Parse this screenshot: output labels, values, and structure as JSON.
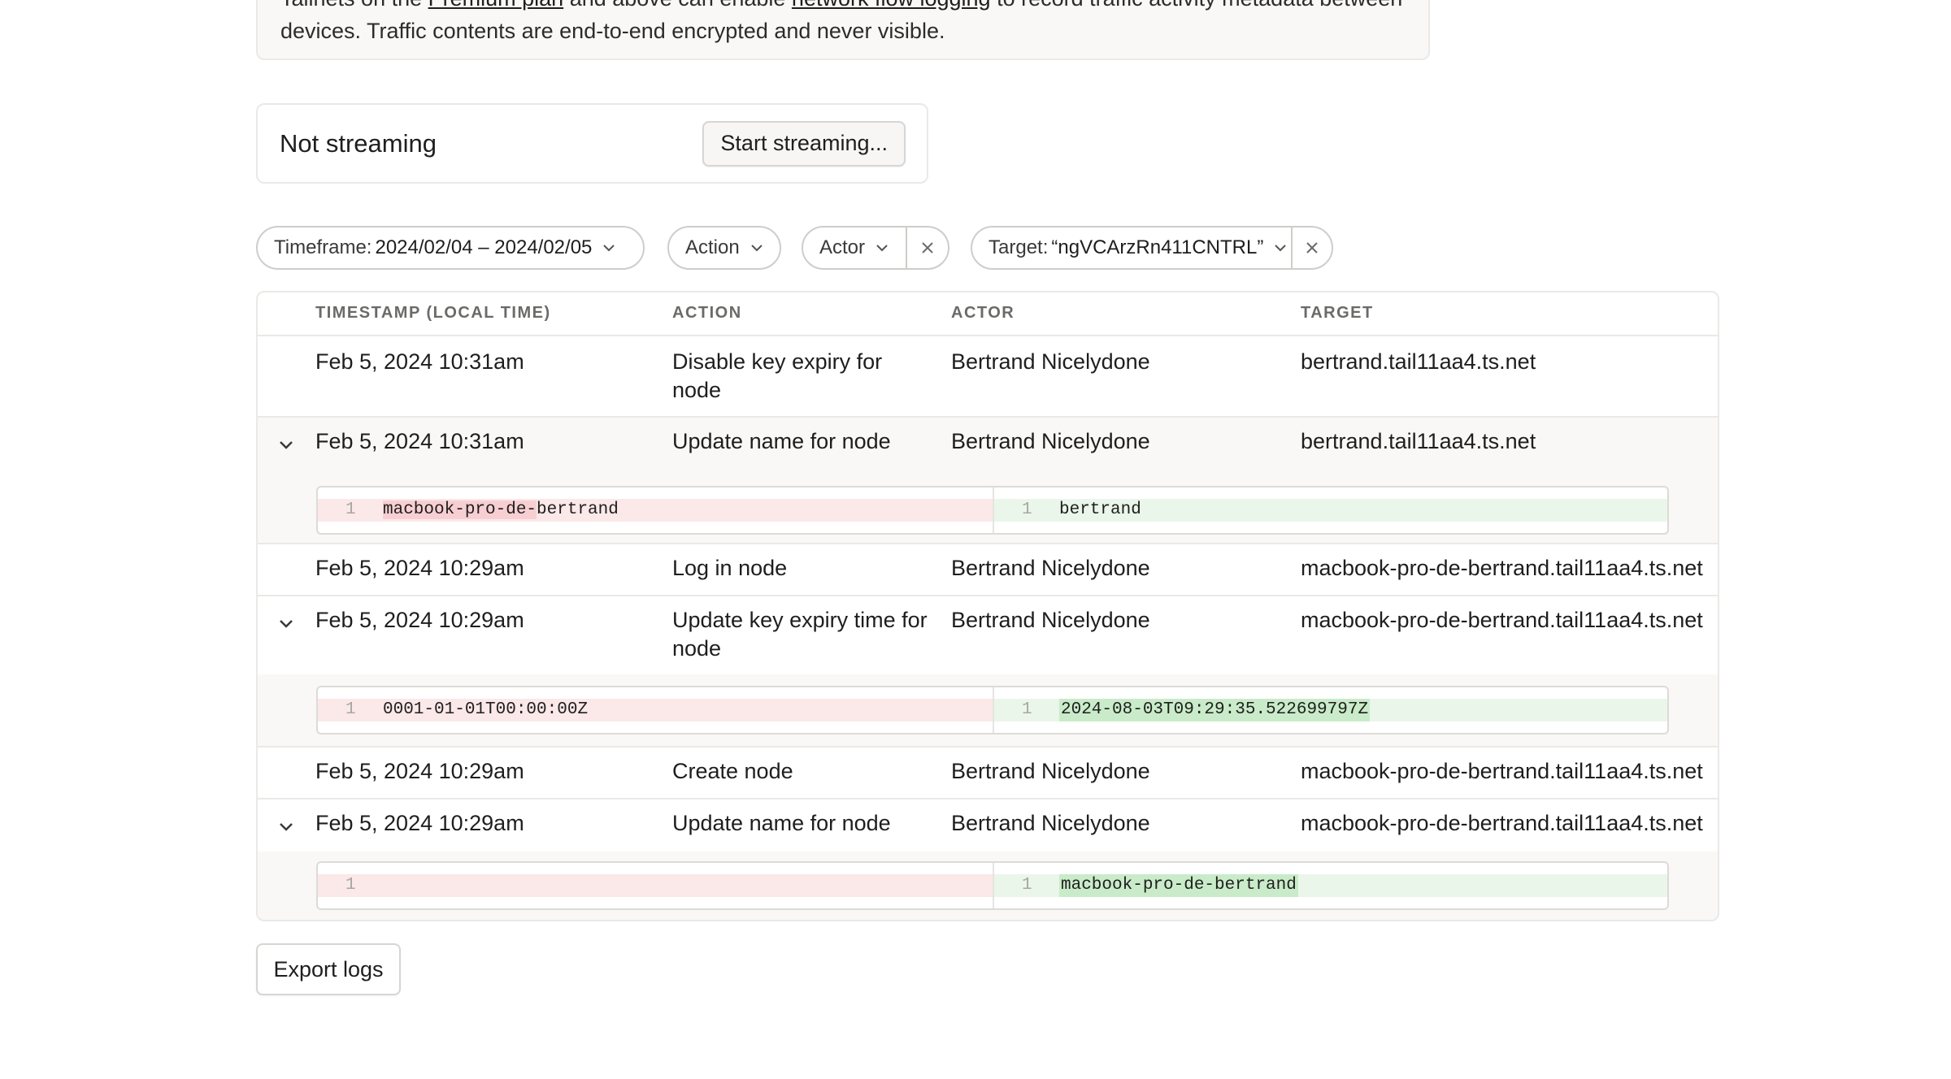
{
  "banner": {
    "text_1": "Tailnets on the ",
    "link_premium": "Premium plan",
    "text_2": " and above can enable ",
    "link_flow": "network flow logging",
    "text_3": " to record traffic activity metadata between",
    "line2": "devices. Traffic contents are end-to-end encrypted and never visible."
  },
  "streaming": {
    "status": "Not streaming",
    "button": "Start streaming..."
  },
  "filters": {
    "timeframe_label": "Timeframe:",
    "timeframe_value": "2024/02/04 – 2024/02/05",
    "action_label": "Action",
    "actor_label": "Actor",
    "target_label": "Target:",
    "target_value": "“ngVCArzRn411CNTRL”"
  },
  "table": {
    "headers": {
      "timestamp": "TIMESTAMP (LOCAL TIME)",
      "action": "ACTION",
      "actor": "ACTOR",
      "target": "TARGET"
    },
    "rows": [
      {
        "timestamp": "Feb 5, 2024 10:31am",
        "action_1": "Disable key expiry for",
        "action_2": "node",
        "actor": "Bertrand Nicelydone",
        "target": "bertrand.tail11aa4.ts.net"
      },
      {
        "timestamp": "Feb 5, 2024 10:31am",
        "action": "Update name for node",
        "actor": "Bertrand Nicelydone",
        "target": "bertrand.tail11aa4.ts.net",
        "diff": {
          "old_line": "1",
          "old_del": "macbook-pro-de-",
          "old_keep": "bertrand",
          "new_line": "1",
          "new_text": "bertrand"
        }
      },
      {
        "timestamp": "Feb 5, 2024 10:29am",
        "action": "Log in node",
        "actor": "Bertrand Nicelydone",
        "target": "macbook-pro-de-bertrand.tail11aa4.ts.net"
      },
      {
        "timestamp": "Feb 5, 2024 10:29am",
        "action_1": "Update key expiry time for",
        "action_2": "node",
        "actor": "Bertrand Nicelydone",
        "target": "macbook-pro-de-bertrand.tail11aa4.ts.net",
        "diff": {
          "old_line": "1",
          "old_text": "0001-01-01T00:00:00Z",
          "new_line": "1",
          "new_text": "2024-08-03T09:29:35.522699797Z"
        }
      },
      {
        "timestamp": "Feb 5, 2024 10:29am",
        "action": "Create node",
        "actor": "Bertrand Nicelydone",
        "target": "macbook-pro-de-bertrand.tail11aa4.ts.net"
      },
      {
        "timestamp": "Feb 5, 2024 10:29am",
        "action": "Update name for node",
        "actor": "Bertrand Nicelydone",
        "target": "macbook-pro-de-bertrand.tail11aa4.ts.net",
        "diff": {
          "old_line": "1",
          "old_text": "",
          "new_line": "1",
          "new_text": "macbook-pro-de-bertrand"
        }
      }
    ]
  },
  "export_button": "Export logs",
  "colors": {
    "deleted_bg": "#fbe8e9",
    "inserted_bg": "#eaf6ea",
    "border": "#ebe9e6"
  }
}
